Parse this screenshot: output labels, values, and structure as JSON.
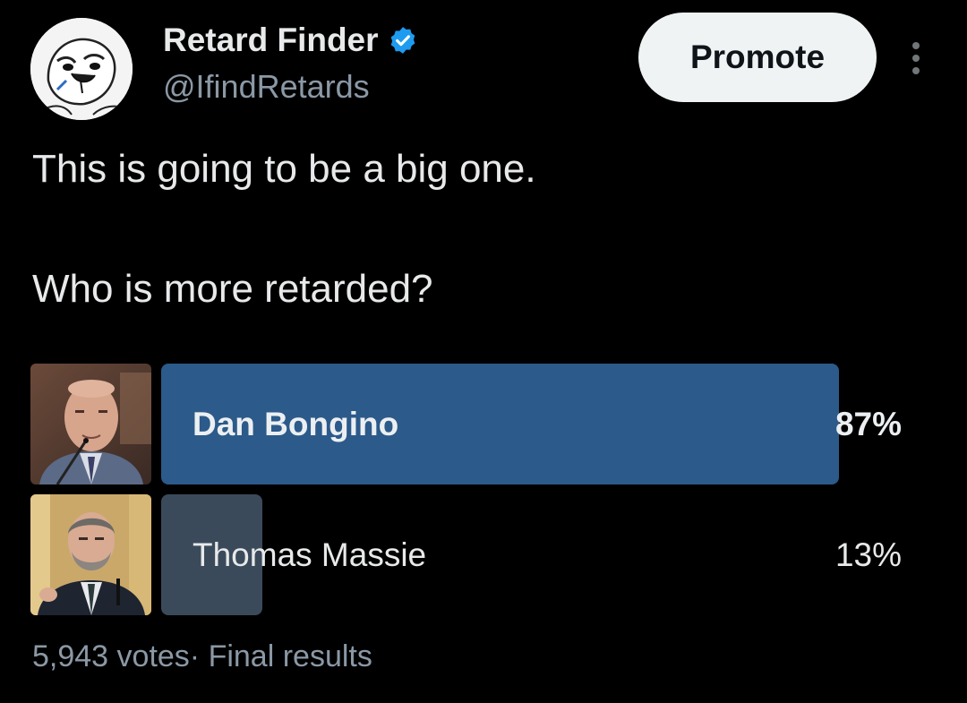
{
  "author": {
    "display_name": "Retard Finder",
    "handle": "@IfindRetards",
    "avatar_icon": "meme-face-avatar",
    "verified_icon": "verified-badge-icon",
    "verified_color": "#1d9bf0"
  },
  "actions": {
    "promote_label": "Promote",
    "more_icon": "more-vertical-icon"
  },
  "tweet": {
    "line1": "This is going to be a big one.",
    "line2": "Who is more retarded?"
  },
  "poll": {
    "options": [
      {
        "label": "Dan Bongino",
        "percent_label": "87%",
        "percent": 87,
        "bar_color": "#2c5a8a",
        "leading": true
      },
      {
        "label": "Thomas Massie",
        "percent_label": "13%",
        "percent": 13,
        "bar_color": "#3b4a5a",
        "leading": false
      }
    ],
    "votes": "5,943 votes",
    "separator": "·",
    "status": "Final results"
  },
  "colors": {
    "background": "#000000",
    "text_primary": "#e7e9ea",
    "text_secondary": "#8b98a5",
    "promote_bg": "#eff3f4"
  }
}
